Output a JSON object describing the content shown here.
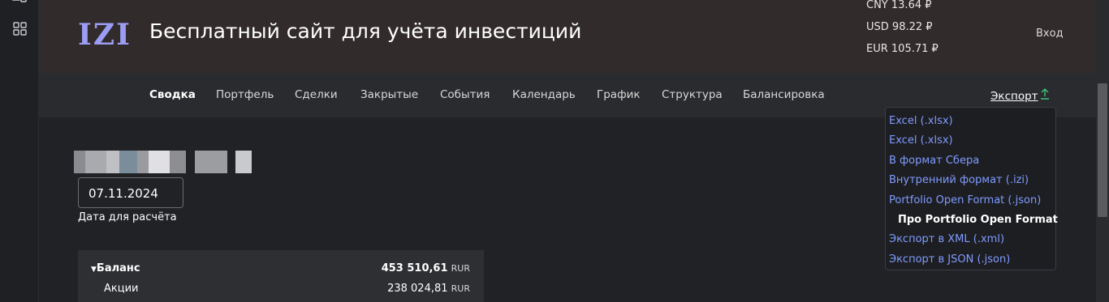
{
  "header": {
    "logo": "IZI",
    "title": "Бесплатный сайт для учёта инвестиций",
    "rates": [
      {
        "code": "CNY",
        "value": "13.64 ₽"
      },
      {
        "code": "USD",
        "value": "98.22 ₽"
      },
      {
        "code": "EUR",
        "value": "105.71 ₽"
      }
    ],
    "login": "Вход"
  },
  "nav": {
    "items": [
      "Сводка",
      "Портфель",
      "Сделки",
      "Закрытые",
      "События",
      "Календарь",
      "График",
      "Структура",
      "Балансировка"
    ],
    "export_label": "Экспорт",
    "export_icon": "upload-arrow-icon"
  },
  "export_menu": [
    "Excel (.xlsx)",
    "Excel (.xlsx)",
    "В формат Сбера",
    "Внутренний формат (.izi)",
    "Portfolio Open Format (.json)",
    "Про Portfolio Open Format",
    "Экспорт в XML (.xml)",
    "Экспорт в JSON (.json)"
  ],
  "calc": {
    "date_value": "07.11.2024",
    "date_label": "Дата для расчёта"
  },
  "balance": {
    "title": "Баланс",
    "total": "453 510,61",
    "currency": "RUR",
    "rows": [
      {
        "name": "Акции",
        "value": "238 024,81",
        "currency": "RUR"
      }
    ]
  },
  "colors": {
    "accent_logo": "#9b9cf3",
    "link": "#7f9bff",
    "export_arrow": "#3ec27a"
  }
}
